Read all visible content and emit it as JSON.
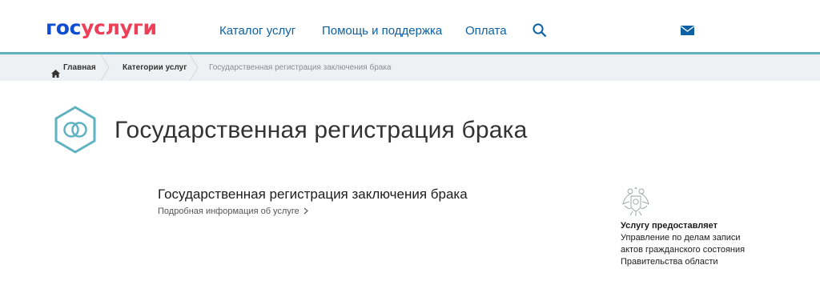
{
  "header": {
    "logo_part1": "гос",
    "logo_part2": "услуги",
    "nav": [
      "Каталог услуг",
      "Помощь и поддержка",
      "Оплата"
    ],
    "search_icon": "search-icon",
    "mail_icon": "mail-icon"
  },
  "breadcrumb": {
    "home": "Главная",
    "category": "Категории услуг",
    "current": "Государственная регистрация заключения брака"
  },
  "page": {
    "title": "Государственная регистрация брака",
    "icon": "rings-icon"
  },
  "service": {
    "title": "Государственная регистрация заключения брака",
    "more_link": "Подробная информация об услуге"
  },
  "provider": {
    "label": "Услугу предоставляет",
    "lines": [
      "Управление по делам записи",
      "актов гражданского состояния",
      "Правительства области"
    ]
  },
  "colors": {
    "brand_blue": "#0d4cd3",
    "brand_red": "#ee3f58",
    "nav_link": "#0b61a4",
    "accent_teal": "#5fb3c1",
    "breadcrumb_bg": "#eef1f3"
  }
}
